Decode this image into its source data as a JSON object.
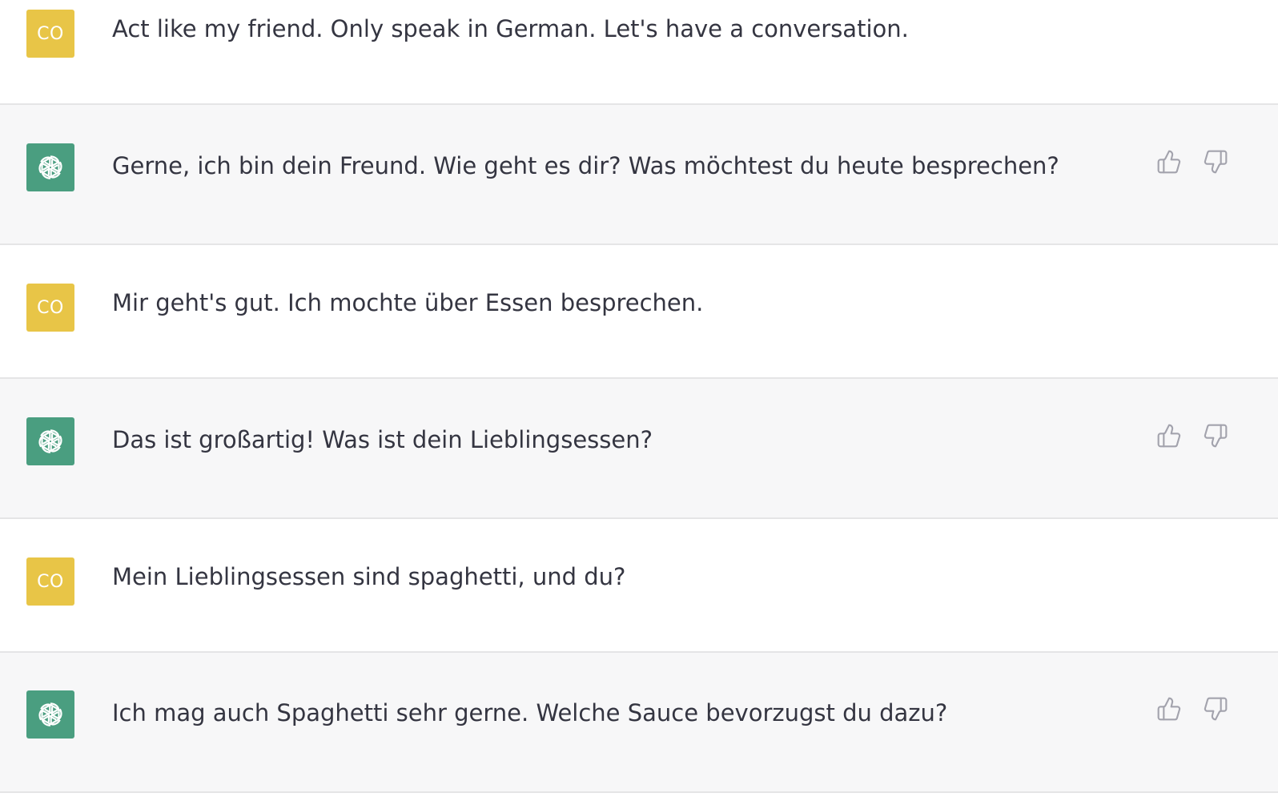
{
  "conversation": [
    {
      "role": "user",
      "avatar_initials": "CO",
      "text": "Act like my friend. Only speak in German. Let's have a conversation."
    },
    {
      "role": "assistant",
      "avatar_icon": "openai-logo-icon",
      "text": "Gerne, ich bin dein Freund. Wie geht es dir? Was möchtest du heute besprechen?"
    },
    {
      "role": "user",
      "avatar_initials": "CO",
      "text": "Mir geht's gut. Ich mochte über Essen besprechen."
    },
    {
      "role": "assistant",
      "avatar_icon": "openai-logo-icon",
      "text": "Das ist großartig! Was ist dein Lieblingsessen?"
    },
    {
      "role": "user",
      "avatar_initials": "CO",
      "text": "Mein Lieblingsessen sind spaghetti, und du?"
    },
    {
      "role": "assistant",
      "avatar_icon": "openai-logo-icon",
      "text": "Ich mag auch Spaghetti sehr gerne. Welche Sauce bevorzugst du dazu?"
    }
  ],
  "feedback_icons": [
    "thumbs-up-icon",
    "thumbs-down-icon"
  ],
  "colors": {
    "user_avatar": "#e8c547",
    "assistant_avatar": "#4a9e80",
    "assistant_row_bg": "#f7f7f8",
    "text": "#343541",
    "icon": "#a3a3ad",
    "divider": "#e5e5e6"
  }
}
